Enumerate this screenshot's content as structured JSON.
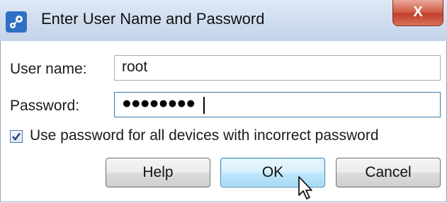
{
  "window": {
    "title": "Enter User Name and Password",
    "close_glyph": "X"
  },
  "form": {
    "username_label": "User name:",
    "username_value": "root",
    "password_label": "Password:",
    "password_mask": "●●●●●●●●",
    "checkbox_label": "Use password for all devices with incorrect password",
    "checkbox_checked": true
  },
  "buttons": {
    "help": "Help",
    "ok": "OK",
    "cancel": "Cancel"
  },
  "icons": {
    "app": "gear-network-icon",
    "close": "close-icon",
    "check": "check-icon",
    "cursor": "mouse-pointer-icon"
  },
  "colors": {
    "titlebar": "#cfdcee",
    "close_button": "#c2412b",
    "default_button_border": "#3c7fb1"
  }
}
